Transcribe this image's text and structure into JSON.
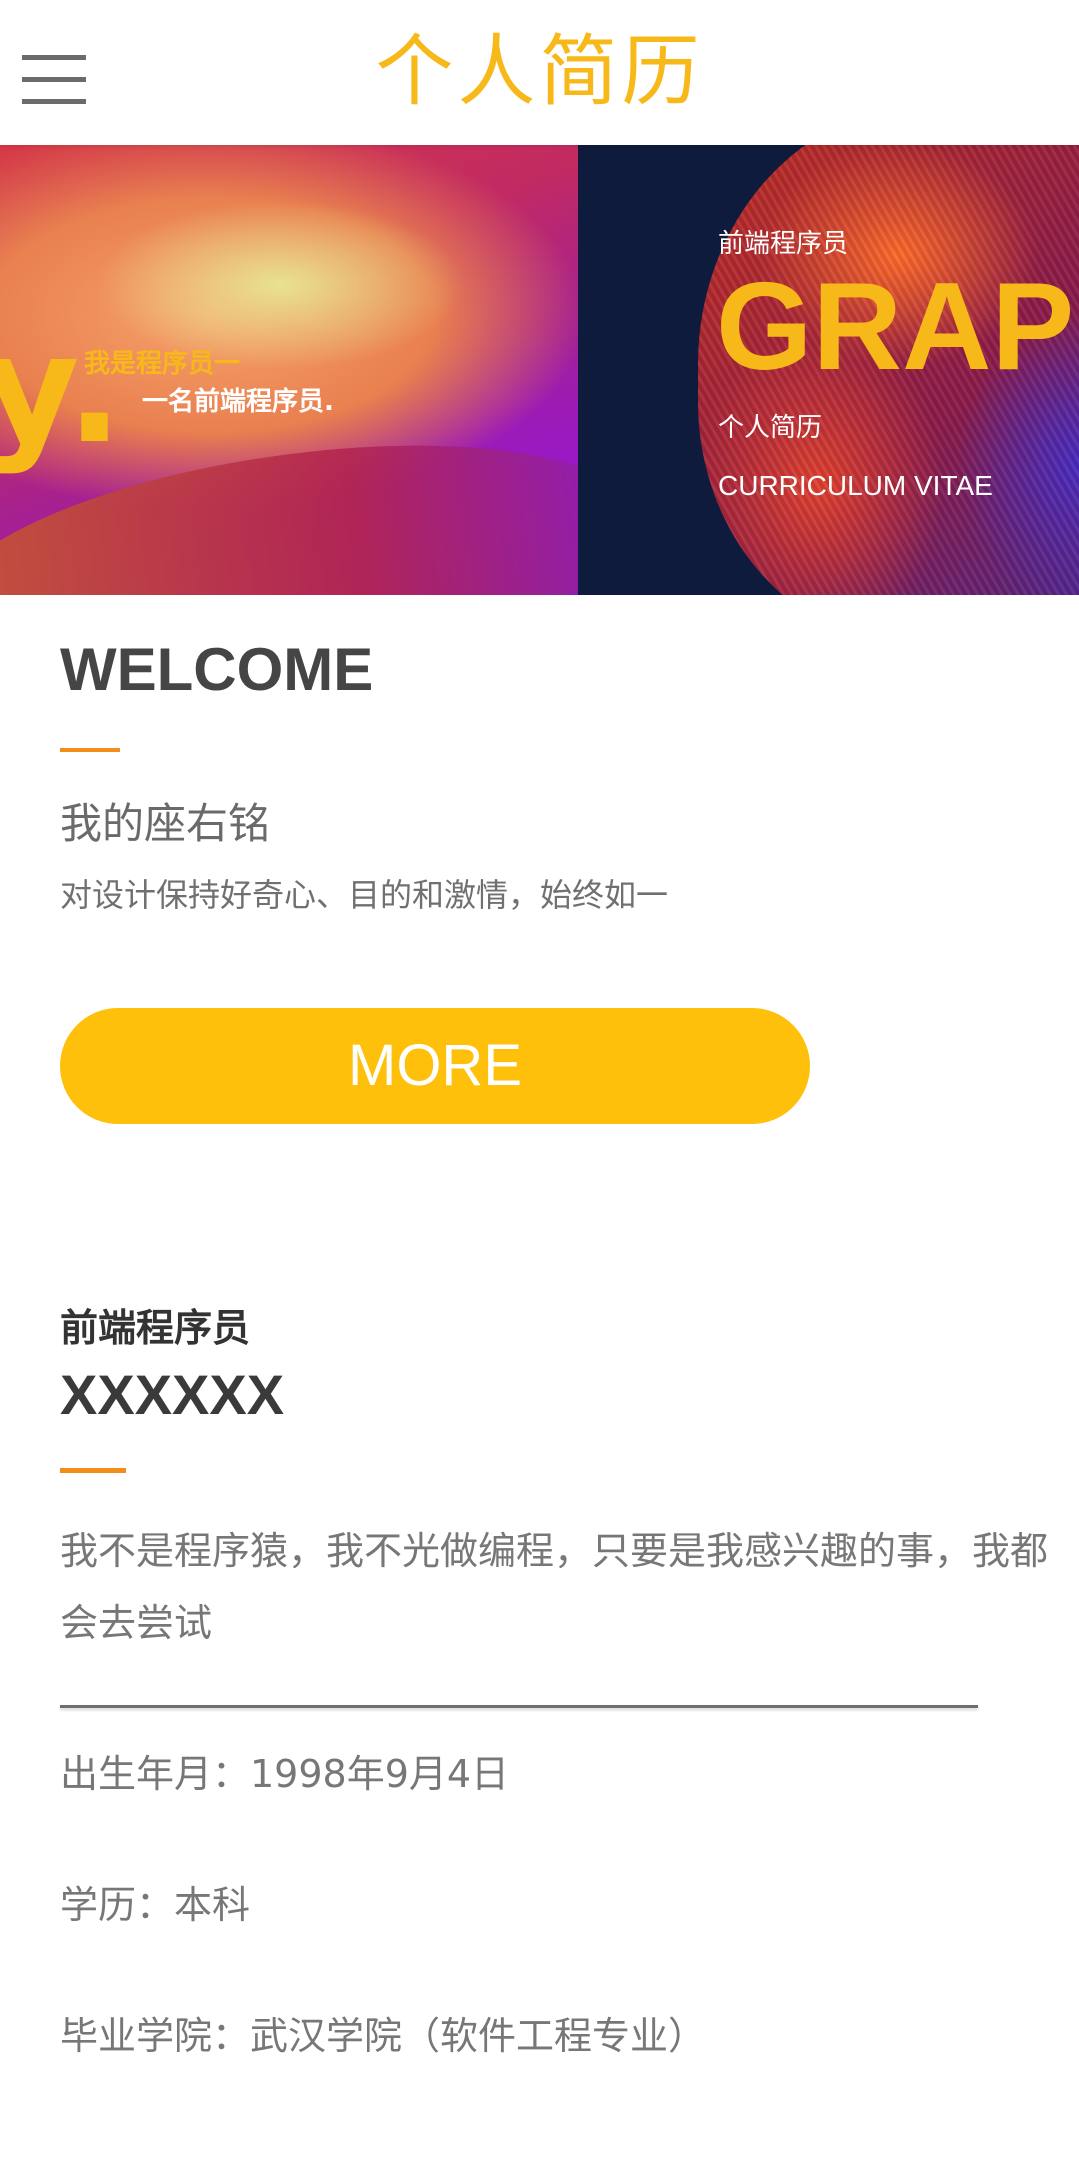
{
  "header": {
    "title": "个人简历",
    "menu_icon": "hamburger-menu-icon"
  },
  "banner": {
    "left": {
      "big_letter": "y.",
      "line1": "我是程序员一",
      "line2": "一名前端程序员."
    },
    "right": {
      "subtitle": "前端程序员",
      "big_word": "GRAPHIC",
      "cn_title": "个人简历",
      "en_title": "CURRICULUM VITAE"
    }
  },
  "welcome": {
    "title": "WELCOME",
    "motto_title": "我的座右铭",
    "motto_text": "对设计保持好奇心、目的和激情，始终如一",
    "more_label": "MORE"
  },
  "profile": {
    "role": "前端程序员",
    "name": "XXXXXX",
    "bio": "我不是程序猿，我不光做编程，只要是我感兴趣的事，我都会去尝试",
    "info": [
      "出生年月：1998年9月4日",
      "学历：本科",
      "毕业学院：武汉学院（软件工程专业）"
    ]
  },
  "colors": {
    "accent_yellow": "#f7b819",
    "button_yellow": "#fec00a",
    "accent_orange": "#f28c1a"
  }
}
